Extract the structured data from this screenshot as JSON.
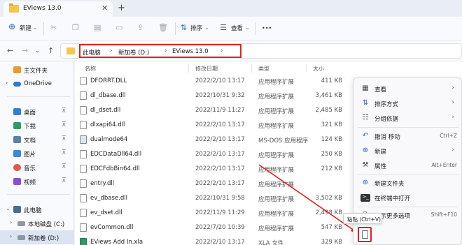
{
  "window": {
    "tab_title": "EViews 13.0",
    "close_glyph": "✕",
    "new_tab_glyph": "+"
  },
  "toolbar": {
    "new_label": "新建",
    "sort_label": "排序",
    "view_label": "查看",
    "more_glyph": "•••"
  },
  "breadcrumb": {
    "items": [
      "此电脑",
      "新加卷 (D:)",
      "EViews 13.0"
    ]
  },
  "sidebar": {
    "items": [
      {
        "label": "主文件夹",
        "icon": "home-icon"
      },
      {
        "label": "OneDrive",
        "icon": "cloud-icon"
      },
      {
        "label": "桌面",
        "icon": "desktop-icon"
      },
      {
        "label": "下载",
        "icon": "download-icon"
      },
      {
        "label": "文档",
        "icon": "document-icon"
      },
      {
        "label": "图片",
        "icon": "picture-icon"
      },
      {
        "label": "音乐",
        "icon": "music-icon"
      },
      {
        "label": "视频",
        "icon": "video-icon"
      },
      {
        "label": "此电脑",
        "icon": "computer-icon"
      },
      {
        "label": "本地磁盘 (C:)",
        "icon": "drive-icon"
      },
      {
        "label": "新加卷 (D:)",
        "icon": "drive-icon"
      }
    ]
  },
  "columns": {
    "name": "名称",
    "date": "修改日期",
    "type": "类型",
    "size": "大小"
  },
  "files": [
    {
      "name": "DFORRT.DLL",
      "date": "2022/2/10 13:17",
      "type": "应用程序扩展",
      "size": "411 KB"
    },
    {
      "name": "dl_dbase.dll",
      "date": "2022/10/31 9:32",
      "type": "应用程序扩展",
      "size": "3,461 KB"
    },
    {
      "name": "dl_dset.dll",
      "date": "2022/11/9 11:27",
      "type": "应用程序扩展",
      "size": "2,485 KB"
    },
    {
      "name": "dlxapi64.dll",
      "date": "2022/2/10 13:17",
      "type": "应用程序扩展",
      "size": "321 KB"
    },
    {
      "name": "dualmode64",
      "date": "2022/2/10 13:17",
      "type": "MS-DOS 应用程序",
      "size": "124 KB"
    },
    {
      "name": "EDCDataDll64.dll",
      "date": "2022/2/10 13:17",
      "type": "应用程序扩展",
      "size": "250 KB"
    },
    {
      "name": "EDCFdbBin64.dll",
      "date": "2022/2/10 13:17",
      "type": "应用程序扩展",
      "size": "212 KB"
    },
    {
      "name": "entry.dll",
      "date": "2022/2/10 13:17",
      "type": "应用程序扩展",
      "size": ""
    },
    {
      "name": "ev_dbase.dll",
      "date": "2022/10/31 9:58",
      "type": "应用程序扩展",
      "size": "3,502 KB"
    },
    {
      "name": "ev_dset.dll",
      "date": "2022/11/9 11:29",
      "type": "应用程序扩展",
      "size": "2,498 KB"
    },
    {
      "name": "evCommon.dll",
      "date": "2022/7/20 10:39",
      "type": "应用程序扩展",
      "size": "547 KB"
    },
    {
      "name": "EViews Add In.xla",
      "date": "2022/2/10 13:17",
      "type": "XLA 文件",
      "size": "329 KB"
    }
  ],
  "context_menu": {
    "view": "查看",
    "sort": "排序方式",
    "group": "分组依据",
    "undo": "撤消 移动",
    "undo_shortcut": "Ctrl+Z",
    "new": "新建",
    "properties": "属性",
    "properties_shortcut": "Alt+Enter",
    "new_folder": "新建文件夹",
    "terminal": "在终端中打开",
    "more_options": "显示更多选项",
    "more_shortcut": "Shift+F10"
  },
  "tooltip": {
    "paste": "粘贴 (Ctrl+V)"
  },
  "colors": {
    "highlight": "#e02020",
    "folder": "#f5c451",
    "accent": "#2563c9"
  }
}
